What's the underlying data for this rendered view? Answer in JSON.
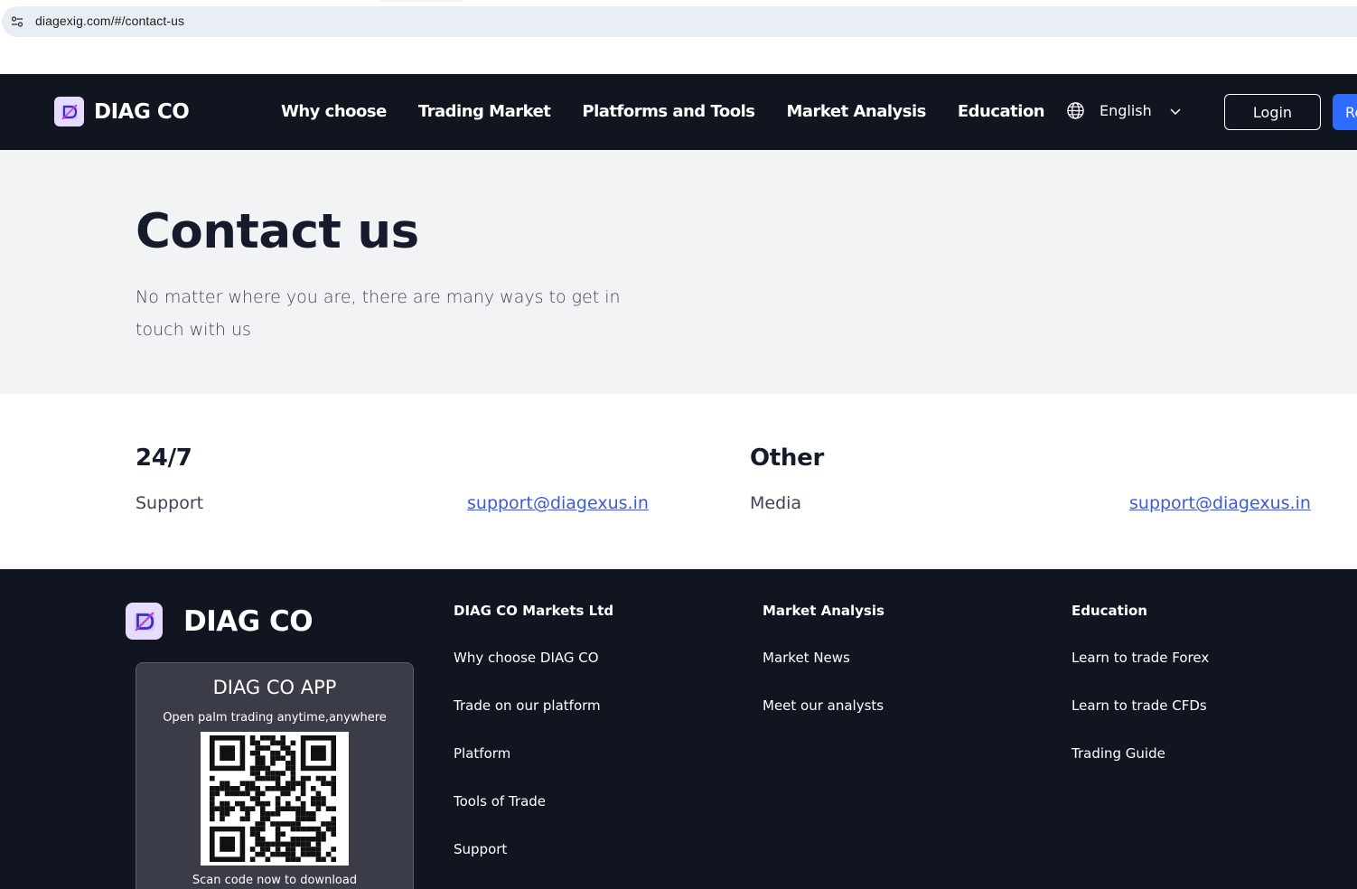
{
  "browser": {
    "url": "diagexig.com/#/contact-us",
    "site_icon": "site-settings-icon"
  },
  "navbar": {
    "logo_text": "DIAG CO",
    "links": [
      "Why choose",
      "Trading Market",
      "Platforms and Tools",
      "Market Analysis",
      "Education"
    ],
    "language": "English",
    "login_label": "Login",
    "register_label": "Re",
    "accent_color": "#2f6bff"
  },
  "hero": {
    "title": "Contact us",
    "subtitle": "No matter where you are, there are many ways to get in touch with us"
  },
  "contact": {
    "blocks": [
      {
        "heading": "24/7",
        "label": "Support",
        "email": "support@diagexus.in"
      },
      {
        "heading": "Other",
        "label": "Media",
        "email": "support@diagexus.in"
      }
    ],
    "link_color": "#3b5bd9"
  },
  "footer": {
    "logo_text": "DIAG CO",
    "app": {
      "title": "DIAG CO APP",
      "subtitle": "Open palm trading anytime,anywhere",
      "scan_text": "Scan code now to download"
    },
    "columns": [
      {
        "heading": "DIAG CO Markets Ltd",
        "items": [
          "Why choose DIAG CO",
          "Trade on our platform",
          "Platform",
          "Tools of Trade",
          "Support"
        ]
      },
      {
        "heading": "Market Analysis",
        "items": [
          "Market News",
          "Meet our analysts"
        ]
      },
      {
        "heading": "Education",
        "items": [
          "Learn to trade Forex",
          "Learn to trade CFDs",
          "Trading Guide"
        ]
      }
    ]
  }
}
